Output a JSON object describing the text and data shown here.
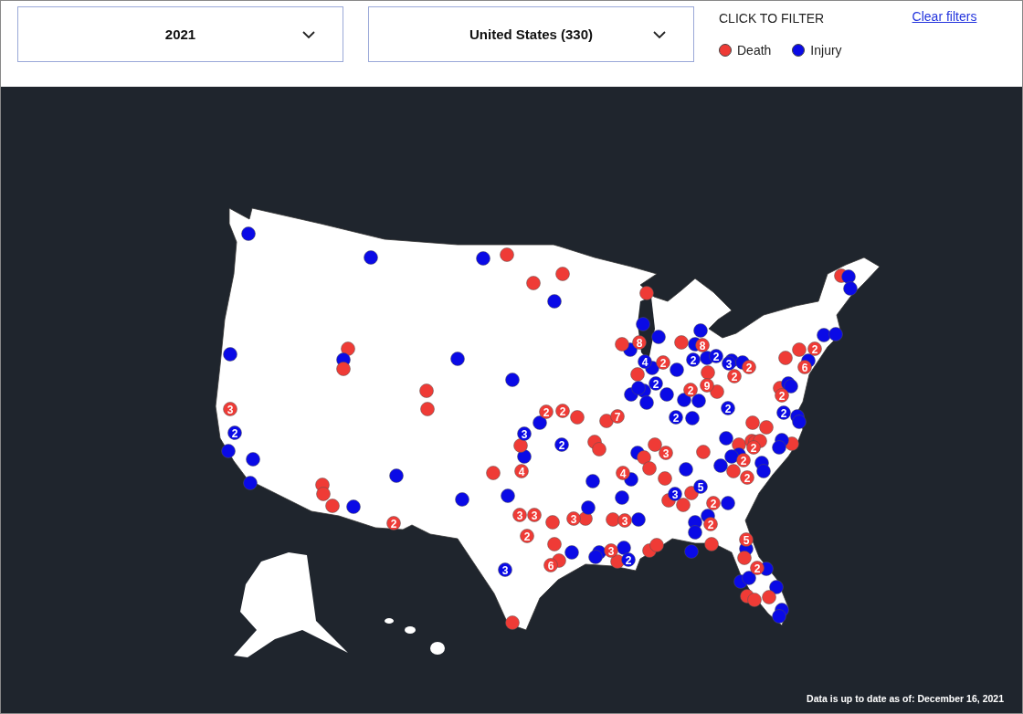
{
  "filters": [
    {
      "value": "2021"
    },
    {
      "value": "United States (330)"
    }
  ],
  "legend": {
    "title": "CLICK TO FILTER",
    "items": [
      {
        "kind": "death",
        "label": "Death",
        "color": "#ef3b36"
      },
      {
        "kind": "injury",
        "label": "Injury",
        "color": "#0a0ae6"
      }
    ]
  },
  "clear_filters": "Clear filters",
  "map": {
    "markers": [
      {
        "kind": "injury"
      },
      {
        "kind": "injury"
      },
      {
        "kind": "injury"
      },
      {
        "kind": "death"
      },
      {
        "kind": "death"
      },
      {
        "kind": "death"
      },
      {
        "kind": "injury"
      },
      {
        "kind": "death"
      },
      {
        "kind": "injury"
      },
      {
        "kind": "death"
      },
      {
        "kind": "injury"
      },
      {
        "kind": "death"
      },
      {
        "kind": "injury"
      },
      {
        "kind": "injury"
      },
      {
        "kind": "death"
      },
      {
        "kind": "death"
      },
      {
        "kind": "injury"
      },
      {
        "kind": "injury"
      },
      {
        "kind": "injury"
      },
      {
        "kind": "death"
      },
      {
        "kind": "death"
      },
      {
        "kind": "death"
      },
      {
        "kind": "injury"
      },
      {
        "kind": "injury"
      },
      {
        "kind": "injury"
      },
      {
        "kind": "death"
      },
      {
        "kind": "injury"
      },
      {
        "kind": "injury"
      },
      {
        "kind": "death"
      },
      {
        "kind": "injury"
      },
      {
        "kind": "death"
      },
      {
        "kind": "death"
      },
      {
        "kind": "death"
      },
      {
        "kind": "death"
      },
      {
        "kind": "injury"
      },
      {
        "kind": "death"
      },
      {
        "kind": "death"
      },
      {
        "kind": "death"
      },
      {
        "kind": "injury"
      },
      {
        "kind": "injury"
      },
      {
        "kind": "death"
      },
      {
        "kind": "death"
      },
      {
        "kind": "death"
      },
      {
        "kind": "injury"
      },
      {
        "kind": "injury"
      },
      {
        "kind": "injury"
      },
      {
        "kind": "injury"
      },
      {
        "kind": "injury"
      },
      {
        "kind": "injury"
      },
      {
        "kind": "death"
      },
      {
        "kind": "injury"
      },
      {
        "kind": "death"
      },
      {
        "kind": "death"
      },
      {
        "kind": "injury"
      },
      {
        "kind": "injury"
      },
      {
        "kind": "death"
      },
      {
        "kind": "injury"
      },
      {
        "kind": "death"
      },
      {
        "kind": "injury"
      },
      {
        "kind": "injury"
      },
      {
        "kind": "death"
      },
      {
        "kind": "injury"
      },
      {
        "kind": "injury"
      },
      {
        "kind": "injury"
      },
      {
        "kind": "injury"
      },
      {
        "kind": "injury"
      },
      {
        "kind": "death"
      },
      {
        "kind": "death"
      },
      {
        "kind": "injury"
      },
      {
        "kind": "injury"
      },
      {
        "kind": "injury"
      },
      {
        "kind": "injury"
      },
      {
        "kind": "injury"
      },
      {
        "kind": "injury"
      },
      {
        "kind": "injury"
      },
      {
        "kind": "injury"
      },
      {
        "kind": "death"
      },
      {
        "kind": "death"
      },
      {
        "kind": "death"
      },
      {
        "kind": "death"
      },
      {
        "kind": "injury"
      },
      {
        "kind": "injury"
      },
      {
        "kind": "injury"
      },
      {
        "kind": "death"
      },
      {
        "kind": "injury"
      },
      {
        "kind": "injury"
      },
      {
        "kind": "injury"
      },
      {
        "kind": "injury"
      },
      {
        "kind": "death"
      },
      {
        "kind": "injury"
      },
      {
        "kind": "injury"
      },
      {
        "kind": "death"
      },
      {
        "kind": "injury"
      },
      {
        "kind": "injury"
      },
      {
        "kind": "death"
      },
      {
        "kind": "death"
      },
      {
        "kind": "death"
      },
      {
        "kind": "death"
      },
      {
        "kind": "injury"
      },
      {
        "kind": "death"
      },
      {
        "kind": "injury"
      },
      {
        "kind": "death"
      },
      {
        "kind": "death"
      },
      {
        "kind": "death"
      },
      {
        "kind": "death"
      },
      {
        "kind": "injury"
      },
      {
        "kind": "injury"
      },
      {
        "kind": "injury"
      },
      {
        "kind": "injury"
      },
      {
        "kind": "injury"
      },
      {
        "kind": "death"
      },
      {
        "kind": "death"
      },
      {
        "kind": "death"
      },
      {
        "kind": "death"
      },
      {
        "kind": "injury"
      },
      {
        "kind": "injury"
      },
      {
        "kind": "injury"
      },
      {
        "kind": "injury"
      },
      {
        "kind": "injury"
      },
      {
        "kind": "death"
      },
      {
        "kind": "injury"
      },
      {
        "kind": "death"
      },
      {
        "kind": "injury"
      },
      {
        "kind": "injury"
      },
      {
        "kind": "injury"
      },
      {
        "kind": "injury"
      },
      {
        "kind": "death"
      },
      {
        "kind": "death"
      },
      {
        "kind": "death"
      },
      {
        "kind": "injury"
      },
      {
        "kind": "injury"
      },
      {
        "kind": "death",
        "count": "3"
      },
      {
        "kind": "injury",
        "count": "2"
      },
      {
        "kind": "death",
        "count": "2"
      },
      {
        "kind": "injury",
        "count": "3"
      },
      {
        "kind": "death",
        "count": "4"
      },
      {
        "kind": "death",
        "count": "2"
      },
      {
        "kind": "death",
        "count": "2"
      },
      {
        "kind": "injury",
        "count": "2"
      },
      {
        "kind": "death",
        "count": "7"
      },
      {
        "kind": "death",
        "count": "3"
      },
      {
        "kind": "death",
        "count": "3"
      },
      {
        "kind": "death",
        "count": "2"
      },
      {
        "kind": "death",
        "count": "6"
      },
      {
        "kind": "injury",
        "count": "3"
      },
      {
        "kind": "death",
        "count": "3"
      },
      {
        "kind": "death",
        "count": "4"
      },
      {
        "kind": "death",
        "count": "3"
      },
      {
        "kind": "death",
        "count": "3"
      },
      {
        "kind": "injury",
        "count": "2"
      },
      {
        "kind": "death",
        "count": "8"
      },
      {
        "kind": "injury",
        "count": "4"
      },
      {
        "kind": "death",
        "count": "2"
      },
      {
        "kind": "death",
        "count": "8"
      },
      {
        "kind": "injury",
        "count": "2"
      },
      {
        "kind": "injury",
        "count": "2"
      },
      {
        "kind": "injury",
        "count": "3"
      },
      {
        "kind": "death",
        "count": "2"
      },
      {
        "kind": "death",
        "count": "2"
      },
      {
        "kind": "death",
        "count": "9"
      },
      {
        "kind": "death",
        "count": "2"
      },
      {
        "kind": "injury",
        "count": "2"
      },
      {
        "kind": "injury",
        "count": "2"
      },
      {
        "kind": "injury",
        "count": "2"
      },
      {
        "kind": "death",
        "count": "2"
      },
      {
        "kind": "death",
        "count": "6"
      },
      {
        "kind": "death",
        "count": "2"
      },
      {
        "kind": "injury",
        "count": "2"
      },
      {
        "kind": "death",
        "count": "3"
      },
      {
        "kind": "death",
        "count": "2"
      },
      {
        "kind": "death",
        "count": "2"
      },
      {
        "kind": "death",
        "count": "2"
      },
      {
        "kind": "injury",
        "count": "3"
      },
      {
        "kind": "injury",
        "count": "5"
      },
      {
        "kind": "death",
        "count": "2"
      },
      {
        "kind": "death",
        "count": "2"
      },
      {
        "kind": "death",
        "count": "5"
      },
      {
        "kind": "death",
        "count": "2"
      }
    ]
  },
  "footnote": "Data is up to date as of: December 16, 2021"
}
